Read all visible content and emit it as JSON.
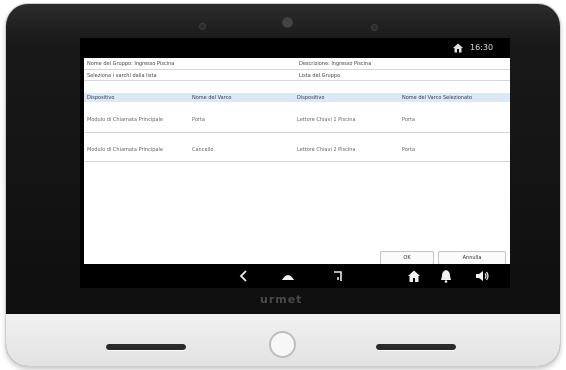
{
  "status_bar": {
    "home_icon": "home-icon",
    "time": "16:30"
  },
  "form": {
    "group_name_label": "Nome del Gruppo: Ingresso Piscina",
    "description_label": "Descrizione: Ingresso Piscina",
    "select_label": "Seleziona i varchi dalla lista",
    "group_list_label": "Lista del Gruppo"
  },
  "left_table": {
    "headers": [
      "Dispositivo",
      "Nome del Varco"
    ],
    "rows": [
      [
        "Modulo di Chiamata Principale",
        "Porta"
      ],
      [
        "Modulo di Chiamata Principale",
        "Cancello"
      ]
    ]
  },
  "right_table": {
    "headers": [
      "Dispositivo",
      "Nome del Varco Selezionato"
    ],
    "rows": [
      [
        "Lettore Chiavi 1 Piscina",
        "Porta"
      ],
      [
        "Lettore Chiavi 2 Piscina",
        "Porta"
      ]
    ]
  },
  "buttons": {
    "ok": "OK",
    "cancel": "Annulla"
  },
  "nav": {
    "icons": [
      "back-icon",
      "home-icon",
      "exit-icon",
      "house-icon",
      "bell-icon",
      "volume-icon"
    ]
  },
  "device": {
    "brand": "urmet"
  },
  "colors": {
    "header_bar": "#dde8f5",
    "screen_bg": "#000000",
    "panel_bg": "#ffffff"
  }
}
